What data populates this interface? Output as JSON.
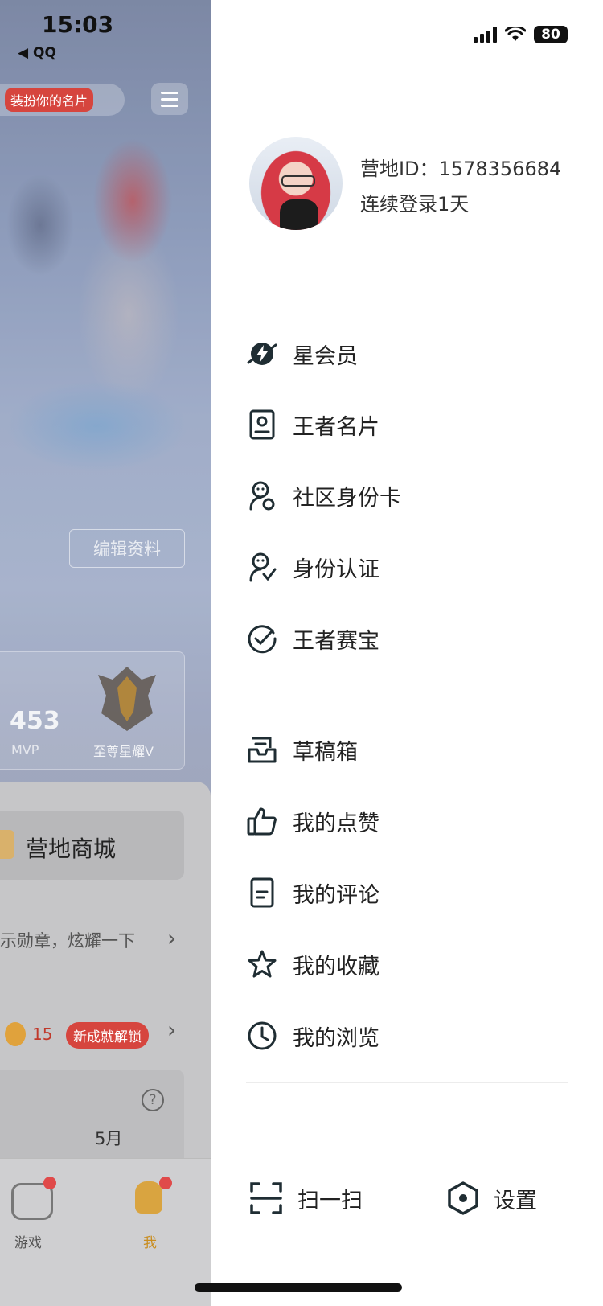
{
  "status_bar": {
    "time": "15:03",
    "back_app": "◀ QQ",
    "battery": "80"
  },
  "background": {
    "dress_card_label": "装扮你的名片",
    "edit_profile": "编辑资料",
    "stats": {
      "mvp_count": "453",
      "mvp_label": "MVP",
      "rank_label": "至尊星耀V"
    },
    "mall_label": "营地商城",
    "medal_text": "示勋章，炫耀一下",
    "achievement_count": "15",
    "achievement_tag": "新成就解锁",
    "month": "5月",
    "tabs": [
      {
        "label": "游戏"
      },
      {
        "label": "我"
      }
    ],
    "colors": {
      "accent_red": "#d6453e",
      "me_tab": "#d9a440"
    }
  },
  "drawer": {
    "profile": {
      "camp_id": "营地ID：1578356684",
      "login_streak": "连续登录1天"
    },
    "menu_group_1": [
      {
        "icon": "star-member-icon",
        "label": "星会员"
      },
      {
        "icon": "name-card-icon",
        "label": "王者名片"
      },
      {
        "icon": "community-id-icon",
        "label": "社区身份卡"
      },
      {
        "icon": "identity-verify-icon",
        "label": "身份认证"
      },
      {
        "icon": "check-circle-icon",
        "label": "王者赛宝"
      }
    ],
    "menu_group_2": [
      {
        "icon": "draft-box-icon",
        "label": "草稿箱"
      },
      {
        "icon": "thumbs-up-icon",
        "label": "我的点赞"
      },
      {
        "icon": "comment-doc-icon",
        "label": "我的评论"
      },
      {
        "icon": "star-icon",
        "label": "我的收藏"
      },
      {
        "icon": "clock-icon",
        "label": "我的浏览"
      }
    ],
    "bottom_actions": {
      "scan": "扫一扫",
      "settings": "设置"
    }
  }
}
